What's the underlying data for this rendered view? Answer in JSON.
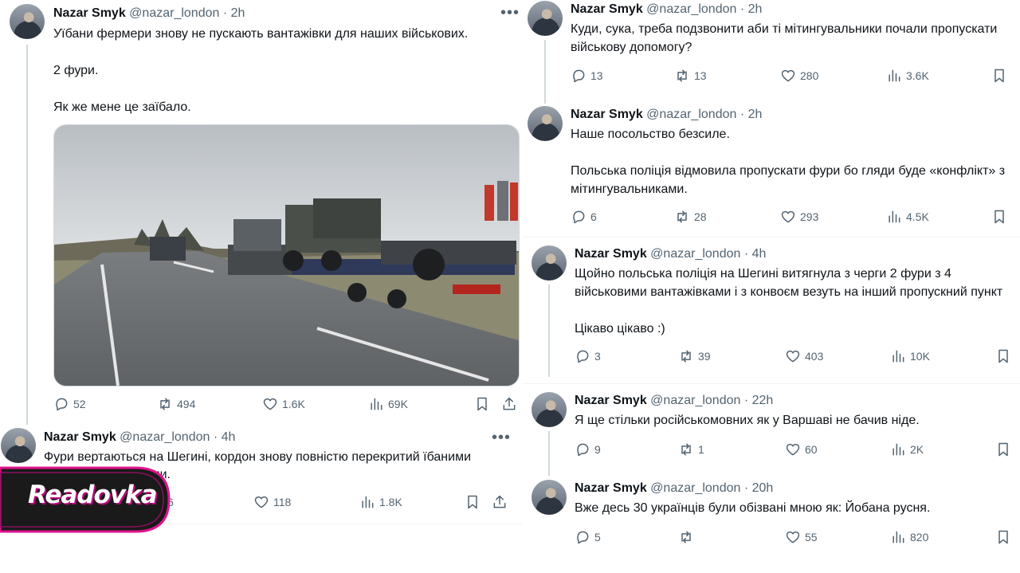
{
  "colors": {
    "text": "#0f1419",
    "secondary": "#536471",
    "divider": "#eff3f4",
    "thread_line": "#cfd9de",
    "brand_magenta": "#e0148c"
  },
  "icons": {
    "reply": "reply-icon",
    "retweet": "retweet-icon",
    "like": "heart-icon",
    "views": "views-icon",
    "bookmark": "bookmark-icon",
    "share": "share-icon",
    "more": "more-icon"
  },
  "tweets": [
    {
      "name": "Nazar Smyk",
      "handle": "@nazar_london",
      "time": "· 2h",
      "more": "•••",
      "text": "Уїбани фермери знову не пускають вантажівки для наших військових.\n\n2 фури.\n\nЯк же мене це заїбало.",
      "replies": "52",
      "retweets": "494",
      "likes": "1.6K",
      "views": "69K"
    },
    {
      "name": "Nazar Smyk",
      "handle": "@nazar_london",
      "time": "· 4h",
      "more": "•••",
      "text": "Фури вертаються на Шегині, кордон знову повністю перекритий їбаними протестувальниками.",
      "replies": "",
      "retweets": "6",
      "likes": "118",
      "views": "1.8K"
    },
    {
      "name": "Nazar Smyk",
      "handle": "@nazar_london",
      "time": "· 2h",
      "text": "Куди, сука, треба подзвонити аби ті мітингувальники почали пропускати військову допомогу?",
      "replies": "13",
      "retweets": "13",
      "likes": "280",
      "views": "3.6K"
    },
    {
      "name": "Nazar Smyk",
      "handle": "@nazar_london",
      "time": "· 2h",
      "text": "Наше посольство безсиле.\n\nПольська поліція відмовила пропускати фури бо гляди буде «конфлікт» з мітингувальниками.",
      "replies": "6",
      "retweets": "28",
      "likes": "293",
      "views": "4.5K"
    },
    {
      "name": "Nazar Smyk",
      "handle": "@nazar_london",
      "time": "· 4h",
      "text": "Щойно польська поліція на Шегині витягнула з черги 2 фури з 4 військовими вантажівками і з конвоєм везуть на інший пропускний пункт\n\nЦікаво цікаво :)",
      "replies": "3",
      "retweets": "39",
      "likes": "403",
      "views": "10K"
    },
    {
      "name": "Nazar Smyk",
      "handle": "@nazar_london",
      "time": "· 22h",
      "text": "Я ще стільки російськомовних як у Варшаві не бачив ніде.",
      "replies": "9",
      "retweets": "1",
      "likes": "60",
      "views": "2K"
    },
    {
      "name": "Nazar Smyk",
      "handle": "@nazar_london",
      "time": "· 20h",
      "text": "Вже десь 30 українців були обізвані мною як: Йобана русня.",
      "replies": "5",
      "retweets": "",
      "likes": "55",
      "views": "820"
    }
  ],
  "watermark": {
    "brand": "Readovka"
  }
}
